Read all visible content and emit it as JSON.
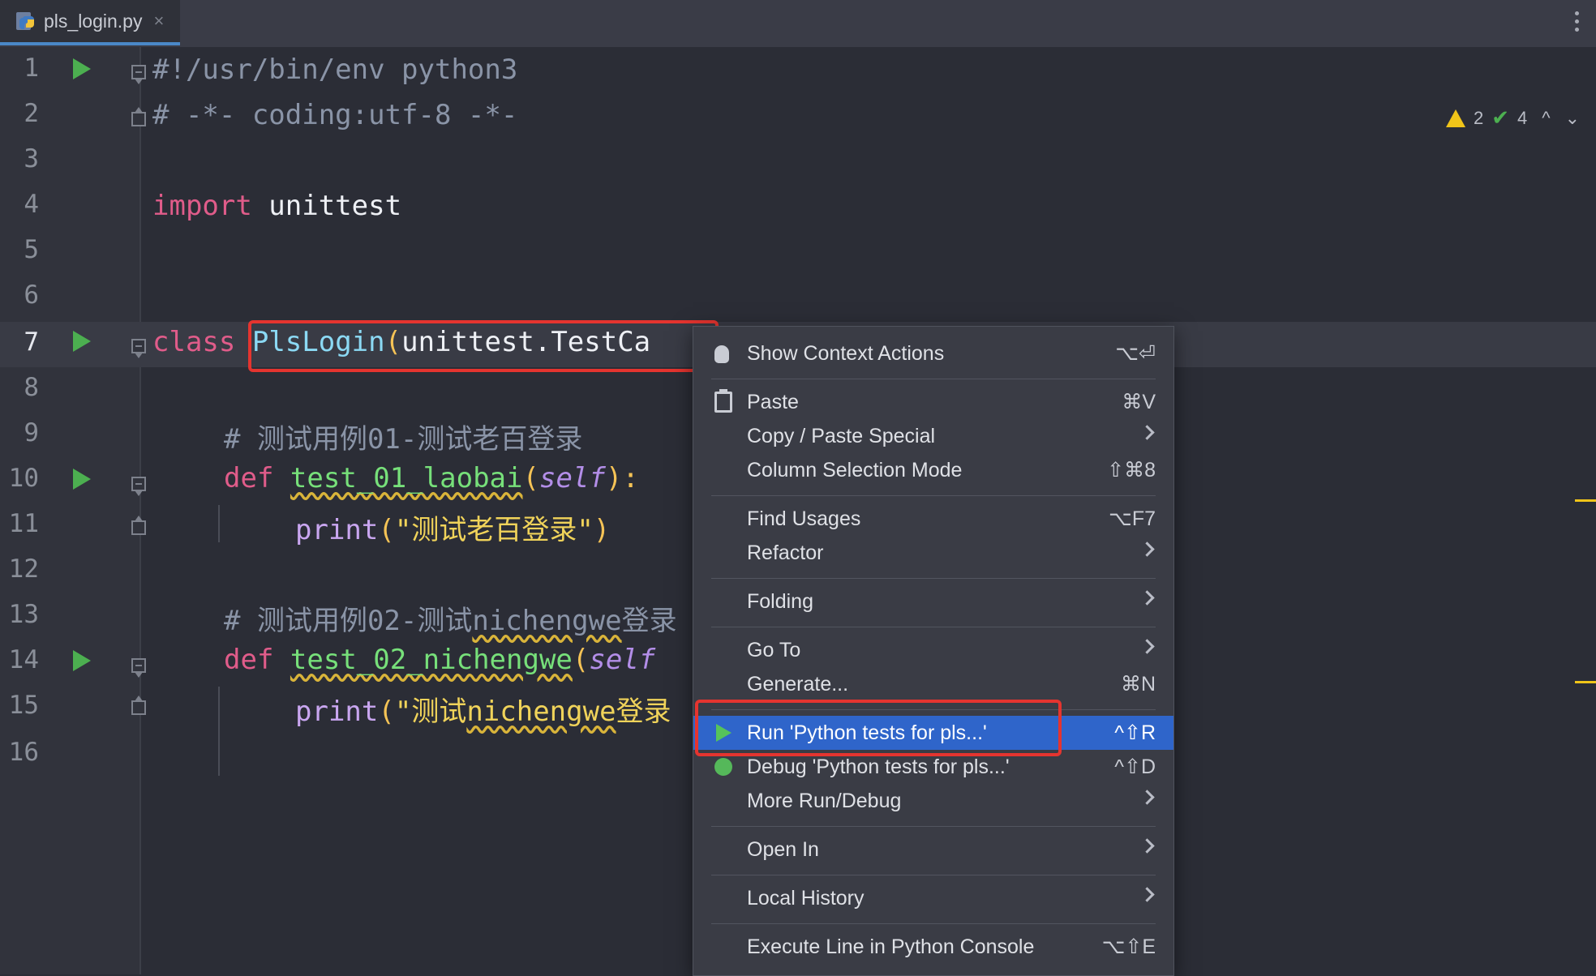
{
  "tab": {
    "filename": "pls_login.py",
    "close": "×"
  },
  "inspections": {
    "warnings": "2",
    "passed": "4",
    "up": "^",
    "down": "⌄"
  },
  "gutter": {
    "line_numbers": [
      "1",
      "2",
      "3",
      "4",
      "5",
      "6",
      "7",
      "8",
      "9",
      "10",
      "11",
      "12",
      "13",
      "14",
      "15",
      "16"
    ]
  },
  "code": {
    "l1": "#!/usr/bin/env python3",
    "l2": "# -*- coding:utf-8 -*-",
    "l4_kw": "import",
    "l4_mod": " unittest",
    "l7_kw": "class",
    "l7_space": " ",
    "l7_cls": "PlsLogin",
    "l7_paren": "(",
    "l7_base": "unittest.TestCa",
    "l9": "# 测试用例01-测试老百登录",
    "l10_kw": "def",
    "l10_space": " ",
    "l10_name": "test_01_laobai",
    "l10_open": "(",
    "l10_self": "self",
    "l10_close": "):",
    "l11_fn": "print",
    "l11_open": "(",
    "l11_str": "\"测试老百登录\"",
    "l11_close": ")",
    "l13_a": "# 测试用例02-测试",
    "l13_b": "nichengwe",
    "l13_c": "登录",
    "l14_kw": "def",
    "l14_space": " ",
    "l14_name": "test_02_nichengwe",
    "l14_open": "(",
    "l14_self": "self",
    "l15_fn": "print",
    "l15_open": "(",
    "l15_str_a": "\"测试",
    "l15_str_b": "nichengwe",
    "l15_str_c": "登录"
  },
  "menu": {
    "items": [
      {
        "label": "Show Context Actions",
        "shortcut": "⌥⏎"
      },
      {
        "label": "Paste",
        "shortcut": "⌘V"
      },
      {
        "label": "Copy / Paste Special",
        "shortcut": ""
      },
      {
        "label": "Column Selection Mode",
        "shortcut": "⇧⌘8"
      },
      {
        "label": "Find Usages",
        "shortcut": "⌥F7"
      },
      {
        "label": "Refactor",
        "shortcut": ""
      },
      {
        "label": "Folding",
        "shortcut": ""
      },
      {
        "label": "Go To",
        "shortcut": ""
      },
      {
        "label": "Generate...",
        "shortcut": "⌘N"
      },
      {
        "label": "Run 'Python tests for pls...'",
        "shortcut": "^⇧R"
      },
      {
        "label": "Debug 'Python tests for pls...'",
        "shortcut": "^⇧D"
      },
      {
        "label": "More Run/Debug",
        "shortcut": ""
      },
      {
        "label": "Open In",
        "shortcut": ""
      },
      {
        "label": "Local History",
        "shortcut": ""
      },
      {
        "label": "Execute Line in Python Console",
        "shortcut": "⌥⇧E"
      }
    ]
  },
  "colors": {
    "selected": "#2f65ca",
    "highlight_border": "#e5342f",
    "run_green": "#4caf50"
  }
}
